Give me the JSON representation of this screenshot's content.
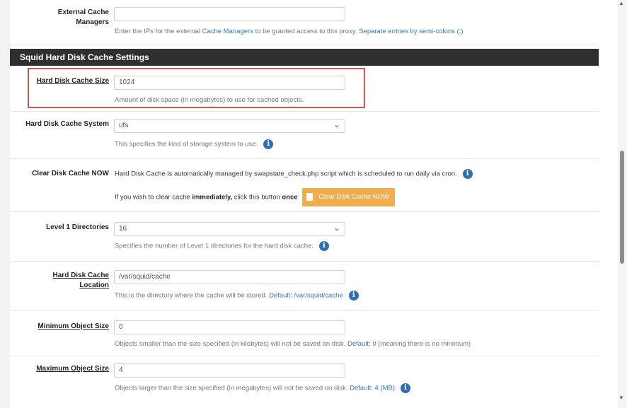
{
  "external_cache": {
    "label": "External Cache Managers",
    "value": "",
    "help_prefix": "Enter the IPs for the external ",
    "help_link": "Cache Managers",
    "help_mid": " to be granted access to this proxy. ",
    "help_link2": "Separate entries by semi-colons (;)"
  },
  "section_title": "Squid Hard Disk Cache Settings",
  "hd_cache_size": {
    "label": "Hard Disk Cache Size",
    "value": "1024",
    "help": "Amount of disk space (in megabytes) to use for cached objects."
  },
  "hd_cache_system": {
    "label": "Hard Disk Cache System",
    "value": "ufs",
    "help": "This specifies the kind of storage system to use."
  },
  "clear_cache": {
    "label": "Clear Disk Cache NOW",
    "line1": "Hard Disk Cache is automatically managed by swapstate_check.php script which is scheduled to run daily via cron.",
    "line2_prefix": "If you wish to clear cache ",
    "line2_bold1": "immediately,",
    "line2_mid": " click this button ",
    "line2_bold2": "once",
    "button": "Clear Disk Cache NOW"
  },
  "level1_dirs": {
    "label": "Level 1 Directories",
    "value": "16",
    "help": "Specifies the number of Level 1 directories for the hard disk cache."
  },
  "hd_cache_location": {
    "label": "Hard Disk Cache Location",
    "value": "/var/squid/cache",
    "help_prefix": "This is the directory where the cache will be stored. ",
    "help_default": "Default: /var/squid/cache"
  },
  "min_object": {
    "label": "Minimum Object Size",
    "value": "0",
    "help_prefix": "Objects smaller than the size specified (in kilobytes) will not be saved on disk. ",
    "help_default": "Default: 0",
    "help_suffix": " (meaning there is no minimum)"
  },
  "max_object": {
    "label": "Maximum Object Size",
    "value": "4",
    "help_prefix": "Objects larger than the size specified (in megabytes) will not be saved on disk. ",
    "help_default": "Default: 4 (MB)"
  },
  "icons": {
    "info": "i"
  },
  "colors": {
    "section_bg": "#2f2f2f",
    "highlight": "#d9534f",
    "warning": "#f0ad4e",
    "link": "#337ab7",
    "info": "#2f6fb5"
  }
}
